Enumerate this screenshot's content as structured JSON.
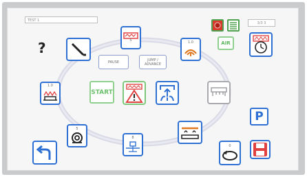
{
  "header": {
    "title_field": "TEST 1",
    "page_indicator": "3/3 3"
  },
  "help_label": "?",
  "buttons": {
    "pause": "PAUSE",
    "jump_advance_line1": "JUMP /",
    "jump_advance_line2": "ADVANCE",
    "start": "START",
    "air": "AIR",
    "park": "P"
  },
  "steps": {
    "top_heater": "5",
    "top_right_blow": "1.0",
    "left_heater": "1.0",
    "bottom_left_roll": "5",
    "bottom_center_press": "8",
    "bottom_right_cycle": "0"
  },
  "colors": {
    "accent": "#2d6fd2",
    "ok": "#6cc16c",
    "alarm": "#e04040",
    "ring": "#dcdcea",
    "heater": "#e04040"
  },
  "icons": [
    "step-down-icon",
    "wave-heater-icon",
    "fan-blow-icon",
    "heater-mold-icon",
    "roll-icon",
    "press-icon",
    "form-base-icon",
    "cycle-counter-icon",
    "heater-warning-icon",
    "ejector-icon",
    "mold-open-icon",
    "emergency-icon",
    "list-icon",
    "timer-heater-icon",
    "back-arrow-icon",
    "save-icon"
  ]
}
